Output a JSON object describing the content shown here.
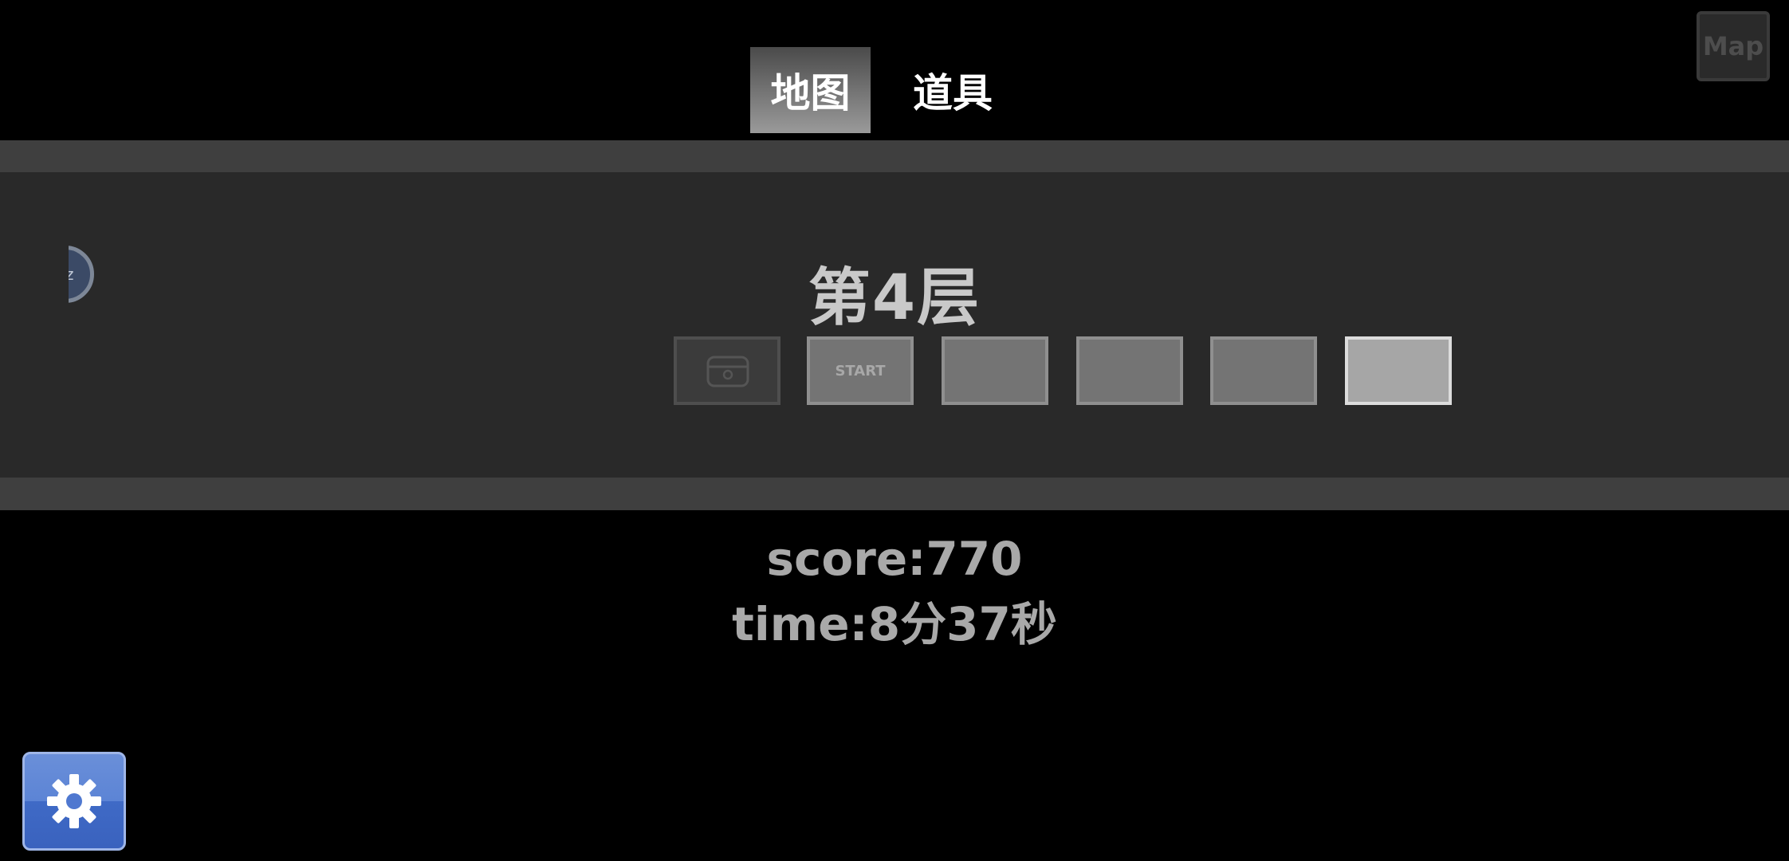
{
  "tabs": [
    {
      "label": "地图",
      "active": true
    },
    {
      "label": "道具",
      "active": false
    }
  ],
  "map_button": {
    "label": "Map"
  },
  "floor": {
    "title": "第4层"
  },
  "rooms": [
    {
      "state": "locked",
      "icon": "treasure-chest-icon"
    },
    {
      "state": "start",
      "label": "START"
    },
    {
      "state": "visited"
    },
    {
      "state": "visited"
    },
    {
      "state": "visited"
    },
    {
      "state": "current"
    }
  ],
  "side_avatar": {
    "label": "zz"
  },
  "stats": {
    "score": "score:770",
    "time": "time:8分37秒"
  },
  "settings": {
    "icon": "gear-icon"
  },
  "colors": {
    "background": "#000000",
    "panel_outer": "#3f3f3f",
    "panel_inner": "#292929",
    "settings_blue": "#4f78d0"
  }
}
